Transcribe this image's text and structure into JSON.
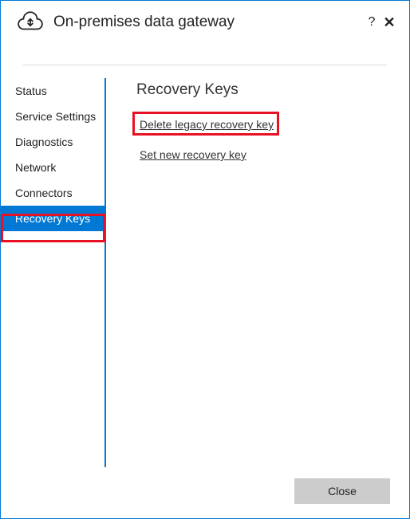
{
  "app": {
    "title": "On-premises data gateway"
  },
  "sidebar": {
    "items": [
      {
        "label": "Status"
      },
      {
        "label": "Service Settings"
      },
      {
        "label": "Diagnostics"
      },
      {
        "label": "Network"
      },
      {
        "label": "Connectors"
      },
      {
        "label": "Recovery Keys"
      }
    ],
    "active_index": 5
  },
  "content": {
    "heading": "Recovery Keys",
    "links": [
      {
        "label": "Delete legacy recovery key",
        "highlighted": true
      },
      {
        "label": "Set new recovery key",
        "highlighted": false
      }
    ]
  },
  "footer": {
    "close_label": "Close"
  }
}
